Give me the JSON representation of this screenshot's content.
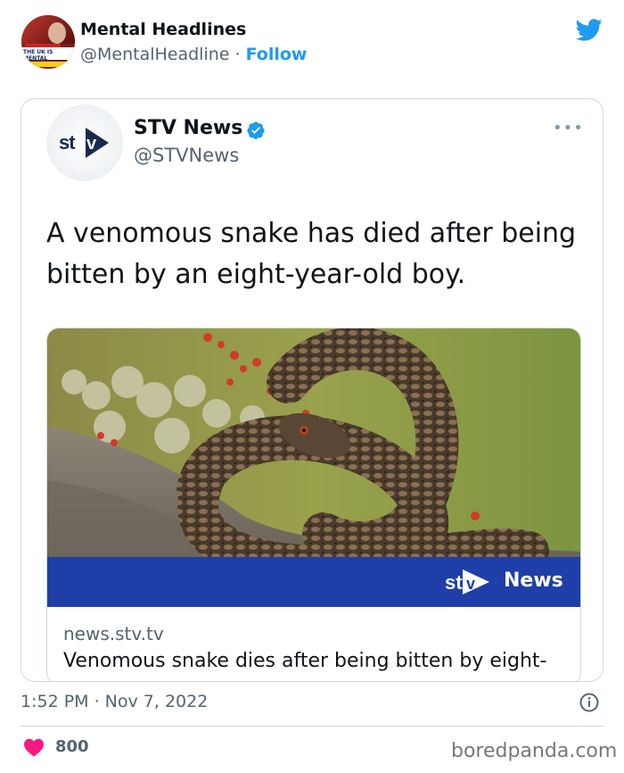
{
  "tweet": {
    "author_name": "Mental Headlines",
    "author_handle": "@MentalHeadline",
    "separator": " · ",
    "follow_label": "Follow",
    "avatar_text": "THE UK IS MENTAL",
    "timestamp": "1:52 PM · Nov 7, 2022",
    "like_count": "800"
  },
  "quote": {
    "name": "STV News",
    "handle": "@STVNews",
    "text": "A venomous snake has died after being bitten by an eight-year-old boy.",
    "card": {
      "domain": "news.stv.tv",
      "title": "Venomous snake dies after being bitten by eight-",
      "banner_text": "News",
      "logo_text": "stv"
    }
  },
  "watermark": "boredpanda.com",
  "colors": {
    "twitter_blue": "#1d9bf0",
    "heart_red": "#f91880",
    "stv_banner": "#1e3fa8"
  },
  "icons": [
    "twitter-bird-icon",
    "verified-badge-icon",
    "more-options-icon",
    "info-icon",
    "heart-icon",
    "stv-logo-icon"
  ]
}
